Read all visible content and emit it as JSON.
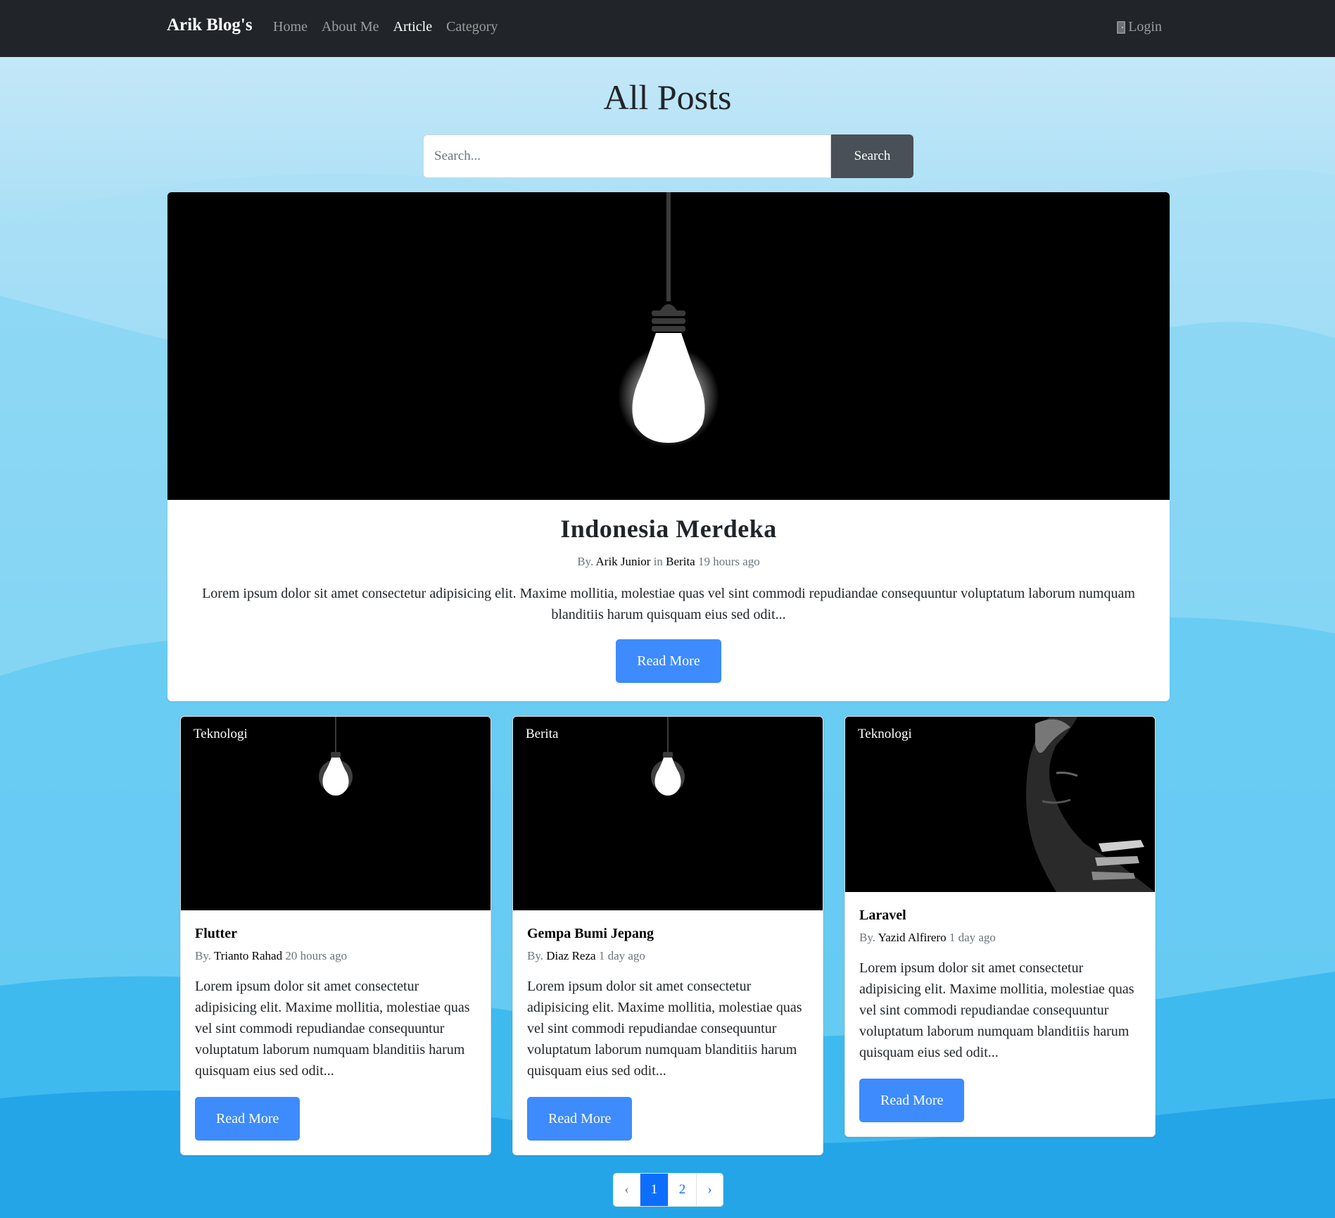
{
  "navbar": {
    "brand": "Arik Blog's",
    "links": [
      {
        "label": "Home",
        "active": false
      },
      {
        "label": "About Me",
        "active": false
      },
      {
        "label": "Article",
        "active": true
      },
      {
        "label": "Category",
        "active": false
      }
    ],
    "login_label": "Login",
    "login_icon": "door-icon"
  },
  "page": {
    "title": "All Posts"
  },
  "search": {
    "placeholder": "Search...",
    "value": "",
    "button_label": "Search"
  },
  "hero_post": {
    "title": "Indonesia Merdeka",
    "by_label": "By.",
    "author": "Arik Junior",
    "in_label": "in",
    "category": "Berita",
    "time": "19 hours ago",
    "excerpt": "Lorem ipsum dolor sit amet consectetur adipisicing elit. Maxime mollitia, molestiae quas vel sint commodi repudiandae consequuntur voluptatum laborum numquam blanditiis harum quisquam eius sed odit...",
    "button_label": "Read More",
    "image": "light-bulb-image"
  },
  "posts": [
    {
      "badge": "Teknologi",
      "image": "light-bulb-image",
      "title": "Flutter",
      "by_label": "By.",
      "author": "Trianto Rahad",
      "time": "20 hours ago",
      "excerpt": "Lorem ipsum dolor sit amet consectetur adipisicing elit. Maxime mollitia, molestiae quas vel sint commodi repudiandae consequuntur voluptatum laborum numquam blanditiis harum quisquam eius sed odit...",
      "button_label": "Read More"
    },
    {
      "badge": "Berita",
      "image": "light-bulb-image",
      "title": "Gempa Bumi Jepang",
      "by_label": "By.",
      "author": "Diaz Reza",
      "time": "1 day ago",
      "excerpt": "Lorem ipsum dolor sit amet consectetur adipisicing elit. Maxime mollitia, molestiae quas vel sint commodi repudiandae consequuntur voluptatum laborum numquam blanditiis harum quisquam eius sed odit...",
      "button_label": "Read More"
    },
    {
      "badge": "Teknologi",
      "image": "dark-face-image",
      "title": "Laravel",
      "by_label": "By.",
      "author": "Yazid Alfirero",
      "time": "1 day ago",
      "excerpt": "Lorem ipsum dolor sit amet consectetur adipisicing elit. Maxime mollitia, molestiae quas vel sint commodi repudiandae consequuntur voluptatum laborum numquam blanditiis harum quisquam eius sed odit...",
      "button_label": "Read More"
    }
  ],
  "pagination": {
    "prev": "‹",
    "pages": [
      "1",
      "2"
    ],
    "active_page": "1",
    "next": "›"
  },
  "colors": {
    "navbar": "#212529",
    "primary_button": "#3d8bfd",
    "search_button": "#495057",
    "background_light": "#c8eaf9",
    "background_dark": "#1aa3ea"
  }
}
